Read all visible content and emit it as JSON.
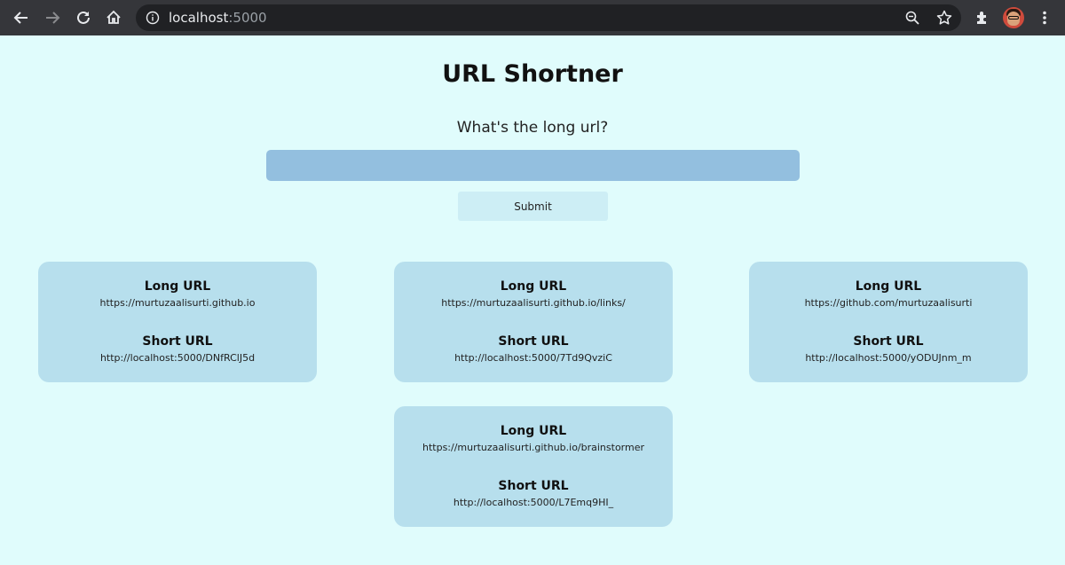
{
  "browser": {
    "url_host": "localhost",
    "url_port": ":5000",
    "icons": [
      "back-icon",
      "forward-icon",
      "reload-icon",
      "home-icon",
      "info-icon",
      "zoom-icon",
      "star-icon",
      "extensions-icon",
      "avatar",
      "menu-icon"
    ]
  },
  "page": {
    "title": "URL Shortner",
    "prompt": "What's the long url?",
    "input_value": "",
    "submit_label": "Submit"
  },
  "cards": [
    {
      "long_label": "Long URL",
      "long_url": "https://murtuzaalisurti.github.io",
      "short_label": "Short URL",
      "short_url": "http://localhost:5000/DNfRClJ5d"
    },
    {
      "long_label": "Long URL",
      "long_url": "https://murtuzaalisurti.github.io/links/",
      "short_label": "Short URL",
      "short_url": "http://localhost:5000/7Td9QvziC"
    },
    {
      "long_label": "Long URL",
      "long_url": "https://github.com/murtuzaalisurti",
      "short_label": "Short URL",
      "short_url": "http://localhost:5000/yODUJnm_m"
    },
    {
      "long_label": "Long URL",
      "long_url": "https://murtuzaalisurti.github.io/brainstormer",
      "short_label": "Short URL",
      "short_url": "http://localhost:5000/L7Emq9HI_"
    }
  ],
  "colors": {
    "page_bg": "#e0fcfc",
    "card_bg": "#b7dfed",
    "input_bg": "#93bfdf",
    "button_bg": "#cdeef5",
    "chrome_bg": "#35363a"
  }
}
